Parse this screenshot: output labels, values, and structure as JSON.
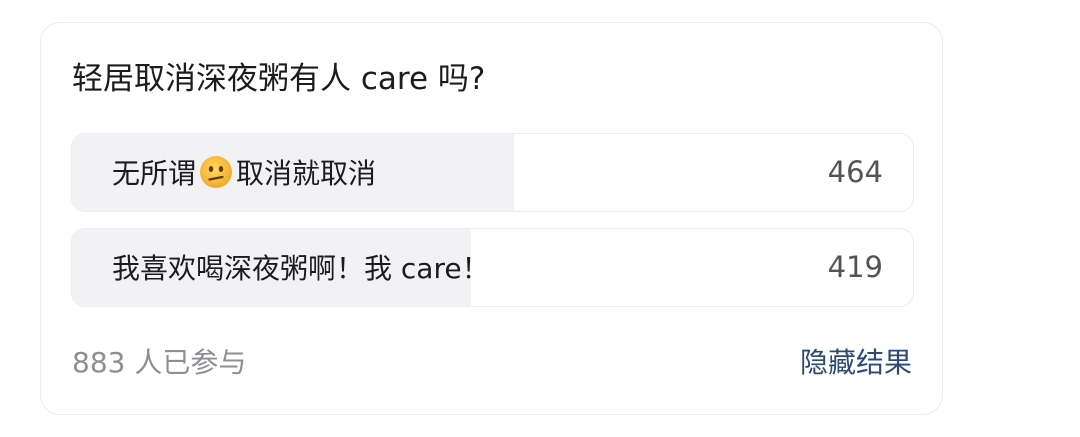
{
  "poll": {
    "title": "轻居取消深夜粥有人 care 吗?",
    "options": [
      {
        "text_before": "无所谓",
        "emoji": "confused-face-emoji",
        "text_after": "取消就取消",
        "count": "464",
        "share": 0.525
      },
      {
        "text": "我喜欢喝深夜粥啊！我 care！",
        "count": "419",
        "share": 0.475
      }
    ],
    "participants": "883 人已参与",
    "hide_results_label": "隐藏结果"
  },
  "colors": {
    "accent": "#2b4a74",
    "bar_fill": "#f2f2f4",
    "emoji_face": "#f7c23a"
  }
}
